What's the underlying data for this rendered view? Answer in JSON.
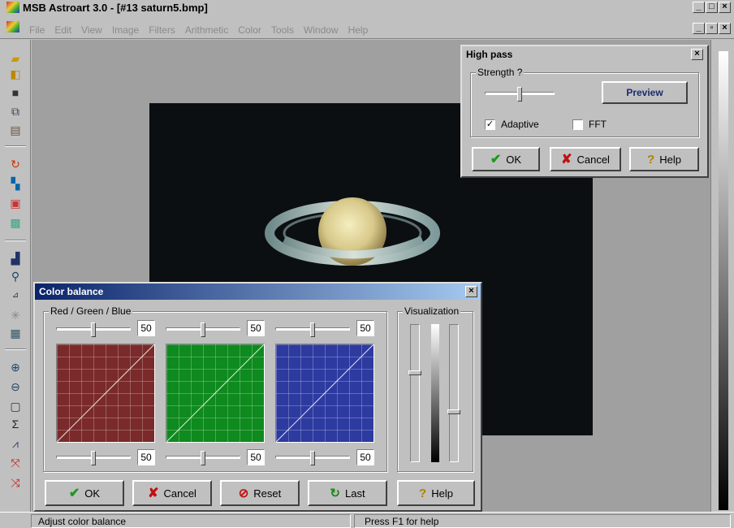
{
  "app": {
    "title": "MSB Astroart 3.0 - [#13 saturn5.bmp]",
    "menu": [
      "File",
      "Edit",
      "View",
      "Image",
      "Filters",
      "Arithmetic",
      "Color",
      "Tools",
      "Window",
      "Help"
    ]
  },
  "status": {
    "left": "Adjust color balance",
    "right": "Press F1 for help"
  },
  "toolbar_icons": [
    "open-folder-icon",
    "open-multiple-icon",
    "save-icon",
    "copy-icon",
    "paste-icon",
    "rotate-icon",
    "align-icon",
    "window-icon",
    "color-image-icon",
    "histogram-icon",
    "zoom-icon",
    "3d-plot-icon",
    "stars-icon",
    "calculator-icon",
    "zoom-in-icon",
    "zoom-out-icon",
    "fit-window-icon",
    "sum-icon",
    "graph-icon",
    "expand-icon",
    "compress-icon"
  ],
  "highpass": {
    "title": "High pass",
    "group": "Strength ?",
    "preview": "Preview",
    "adaptive_label": "Adaptive",
    "adaptive_checked": true,
    "fft_label": "FFT",
    "fft_checked": false,
    "ok": "OK",
    "cancel": "Cancel",
    "help": "Help"
  },
  "colorbal": {
    "title": "Color balance",
    "rgb_group": "Red / Green / Blue",
    "vis_group": "Visualization",
    "channels": [
      {
        "name": "red",
        "top": "50",
        "bottom": "50",
        "color": "#7a2a2a"
      },
      {
        "name": "green",
        "top": "50",
        "bottom": "50",
        "color": "#0e8a1e"
      },
      {
        "name": "blue",
        "top": "50",
        "bottom": "50",
        "color": "#2d3aa0"
      }
    ],
    "ok": "OK",
    "cancel": "Cancel",
    "reset": "Reset",
    "last": "Last",
    "help": "Help"
  },
  "colors": {
    "titlebar_active": "#0a246a",
    "titlebar_active_end": "#a6caf0",
    "titlebar_inactive": "#c0c0c0",
    "workspace": "#a0a0a0"
  }
}
